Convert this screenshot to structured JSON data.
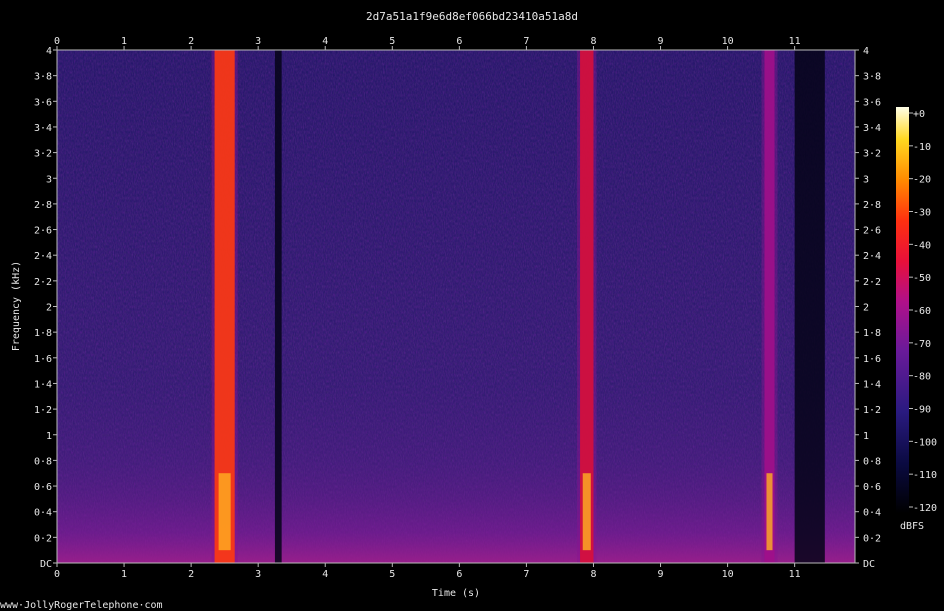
{
  "chart_data": {
    "type": "heatmap",
    "title": "2d7a51a1f9e6d8ef066bd23410a51a8d",
    "xlabel": "Time (s)",
    "ylabel": "Frequency (kHz)",
    "xlim": [
      0,
      11.9
    ],
    "ylim": [
      0,
      4
    ],
    "x_ticks": [
      "0",
      "1",
      "2",
      "3",
      "4",
      "5",
      "6",
      "7",
      "8",
      "9",
      "10",
      "11"
    ],
    "y_ticks": [
      "DC",
      "0·2",
      "0·4",
      "0·6",
      "0·8",
      "1",
      "1·2",
      "1·4",
      "1·6",
      "1·8",
      "2",
      "2·2",
      "2·4",
      "2·6",
      "2·8",
      "3",
      "3·2",
      "3·4",
      "3·6",
      "3·8",
      "4"
    ],
    "colorbar": {
      "label": "dBFS",
      "range": [
        -120,
        0
      ],
      "ticks": [
        "+0",
        "-10",
        "-20",
        "-30",
        "-40",
        "-50",
        "-60",
        "-70",
        "-80",
        "-90",
        "-100",
        "-110",
        "-120"
      ]
    },
    "bursts": [
      {
        "start": 2.35,
        "end": 2.65,
        "level_db": -35
      },
      {
        "start": 7.8,
        "end": 8.0,
        "level_db": -45
      },
      {
        "start": 10.55,
        "end": 10.7,
        "level_db": -55
      }
    ],
    "quiet_bands": [
      {
        "start": 3.25,
        "end": 3.35
      },
      {
        "start": 11.0,
        "end": 11.45
      }
    ]
  },
  "footer": "www·JollyRogerTelephone·com"
}
